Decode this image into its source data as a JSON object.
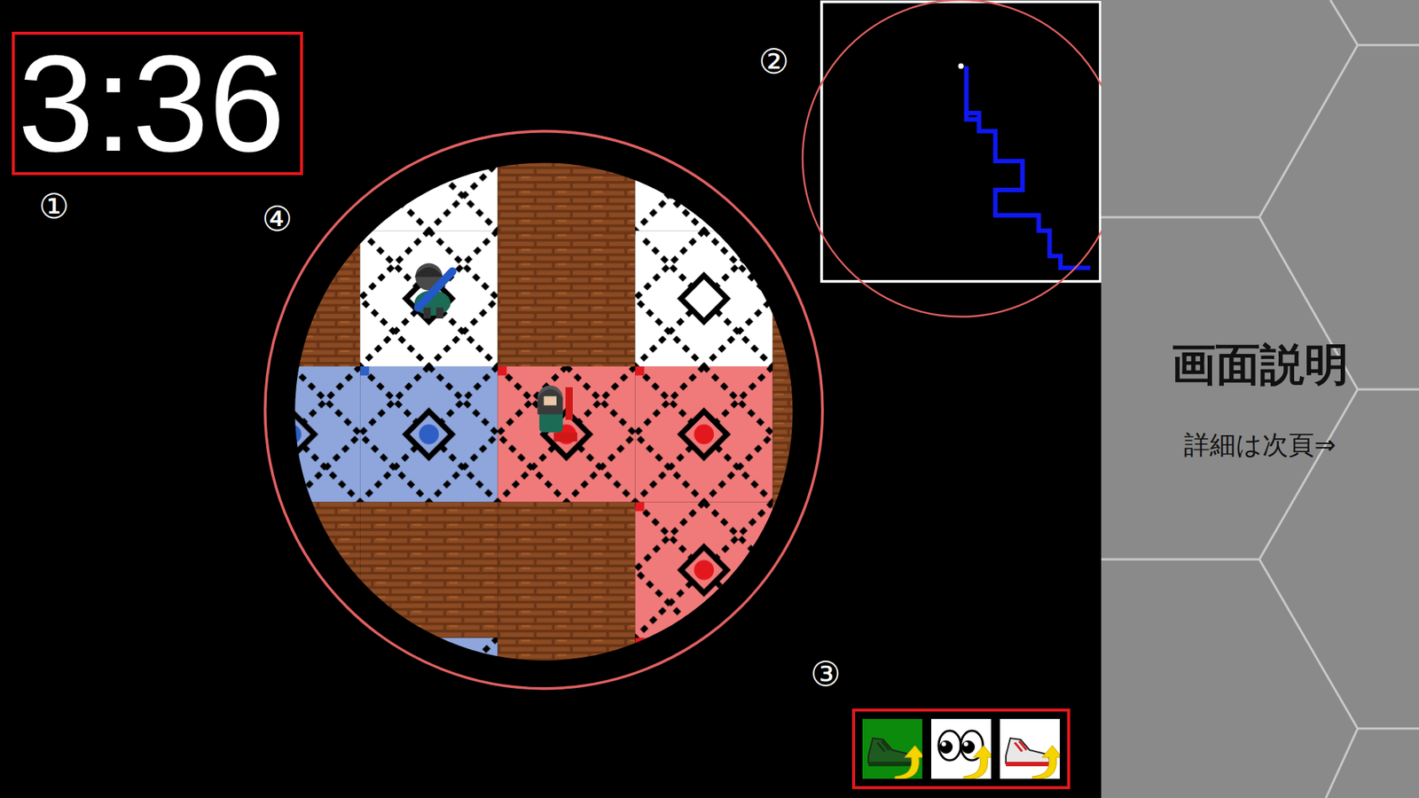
{
  "timer": "3:36",
  "annotations": [
    {
      "label": "①"
    },
    {
      "label": "②"
    },
    {
      "label": "③"
    },
    {
      "label": "④"
    }
  ],
  "panel": {
    "title": "画面説明",
    "subtitle": "詳細は次頁⇒"
  },
  "items": [
    {
      "kind": "speed",
      "selected": true
    },
    {
      "kind": "vision",
      "selected": false
    },
    {
      "kind": "shoes",
      "selected": false
    }
  ]
}
